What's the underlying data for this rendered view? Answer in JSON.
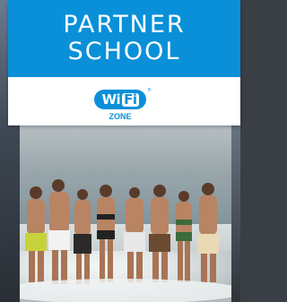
{
  "sign": {
    "title_line1": "PARTNER",
    "title_line2": "SCHOOL",
    "wifi_left": "Wi",
    "wifi_right": "Fi",
    "wifi_zone": "ZONE",
    "registered_mark": "®",
    "brand_color": "#0a90d8"
  },
  "photo": {
    "subject": "group of people standing in the surf on a beach"
  }
}
